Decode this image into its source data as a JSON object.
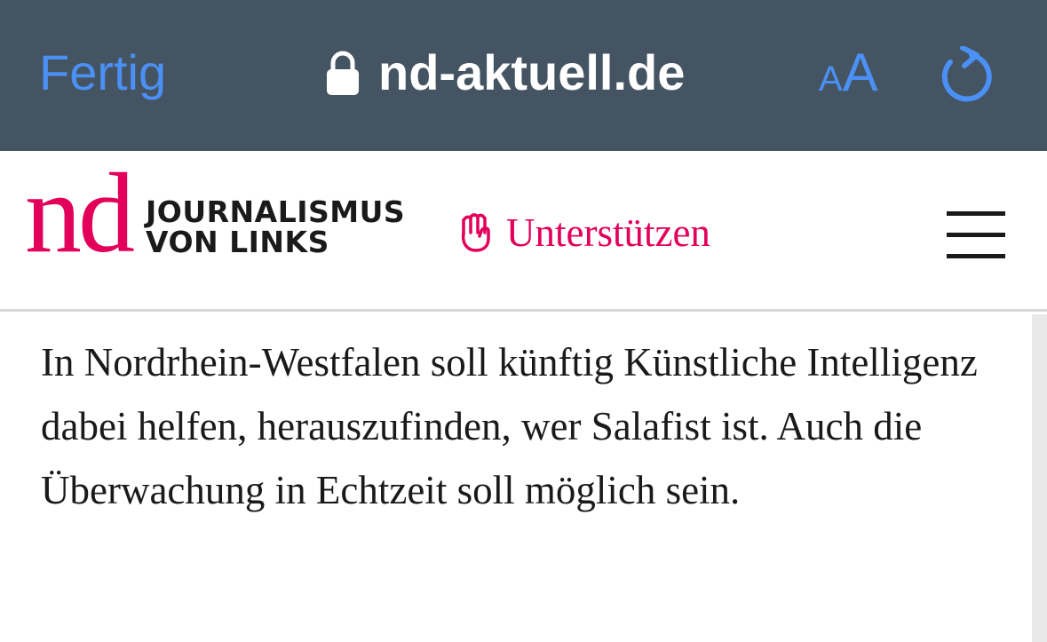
{
  "browser": {
    "done_label": "Fertig",
    "url": "nd-aktuell.de",
    "text_size_small": "A",
    "text_size_large": "A",
    "accent_color": "#4a90f5",
    "bar_color": "#455463"
  },
  "header": {
    "logo_mark": "nd",
    "tagline_line1": "JOURNALISMUS",
    "tagline_line2": "VON LINKS",
    "support_label": "Unterstützen",
    "brand_color": "#e2005a"
  },
  "article": {
    "body": "In Nordrhein-Westfalen soll künftig Künstliche Intelligenz dabei helfen, herauszufinden, wer Salafist ist. Auch die Überwachung in Echtzeit soll möglich sein."
  },
  "icons": {
    "lock": "lock-icon",
    "reload": "reload-icon",
    "fist": "fist-icon",
    "menu": "hamburger-menu-icon"
  }
}
